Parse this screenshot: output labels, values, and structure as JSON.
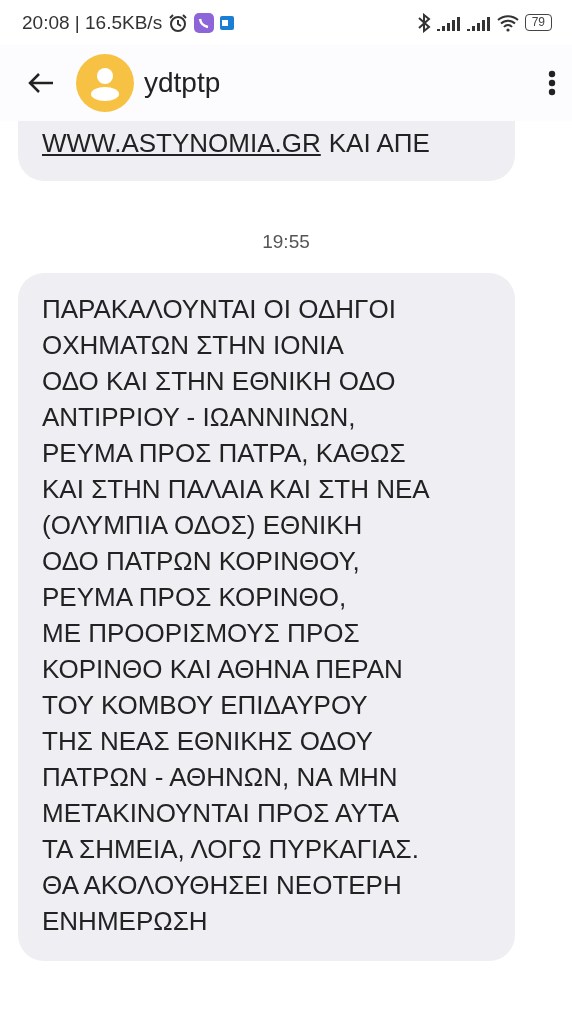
{
  "status_bar": {
    "time_speed": "20:08 | 16.5KB/s",
    "battery": "79"
  },
  "header": {
    "contact_name": "ydtptp"
  },
  "previous_message": {
    "link": "WWW.ASTYNOMIA.GR",
    "after_link": "ΚΑΙ ΑΠΕ"
  },
  "timestamp": "19:55",
  "message": {
    "lines": [
      "ΠΑΡΑΚΑΛΟΥΝΤΑΙ ΟΙ ΟΔΗΓΟΙ",
      "ΟΧΗΜΑΤΩΝ ΣΤΗΝ ΙΟΝΙΑ",
      "ΟΔΟ ΚΑΙ ΣΤΗΝ ΕΘΝΙΚΗ ΟΔΟ",
      "ΑΝΤΙΡΡΙΟΥ - ΙΩΑΝΝΙΝΩΝ,",
      "ΡΕΥΜΑ ΠΡΟΣ ΠΑΤΡΑ, ΚΑΘΩΣ",
      "ΚΑΙ ΣΤΗΝ ΠΑΛΑΙΑ ΚΑΙ ΣΤΗ ΝΕΑ",
      "(ΟΛΥΜΠΙΑ ΟΔΟΣ) ΕΘΝΙΚΗ",
      "ΟΔΟ ΠΑΤΡΩΝ ΚΟΡΙΝΘΟΥ,",
      "ΡΕΥΜΑ ΠΡΟΣ ΚΟΡΙΝΘΟ,",
      "ΜΕ ΠΡΟΟΡΙΣΜΟΥΣ ΠΡΟΣ",
      "ΚΟΡΙΝΘΟ ΚΑΙ ΑΘΗΝΑ ΠΕΡΑΝ",
      "ΤΟΥ ΚΟΜΒΟΥ ΕΠΙΔΑΥΡΟΥ",
      "ΤΗΣ ΝΕΑΣ ΕΘΝΙΚΗΣ ΟΔΟΥ",
      "ΠΑΤΡΩΝ - ΑΘΗΝΩΝ, ΝΑ ΜΗΝ",
      "ΜΕΤΑΚΙΝΟΥΝΤΑΙ ΠΡΟΣ ΑΥΤΑ",
      "ΤΑ ΣΗΜΕΙΑ, ΛΟΓΩ ΠΥΡΚΑΓΙΑΣ.",
      "ΘΑ ΑΚΟΛΟΥΘΗΣΕΙ ΝΕΟΤΕΡΗ",
      "ΕΝΗΜΕΡΩΣΗ"
    ]
  }
}
